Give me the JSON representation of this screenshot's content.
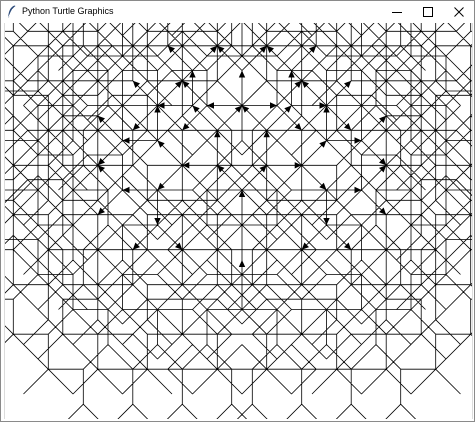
{
  "window": {
    "title": "Python Turtle Graphics",
    "icon": "feather-icon"
  },
  "title_buttons": {
    "minimize_icon": "minimize-icon",
    "maximize_icon": "maximize-icon",
    "close_icon": "close-icon"
  },
  "canvas": {
    "background": "#ffffff",
    "stroke_color": "#000000",
    "drawing": "turtle-fractal-tree",
    "branch_angle_deg": 45,
    "branch_depth": 12
  }
}
